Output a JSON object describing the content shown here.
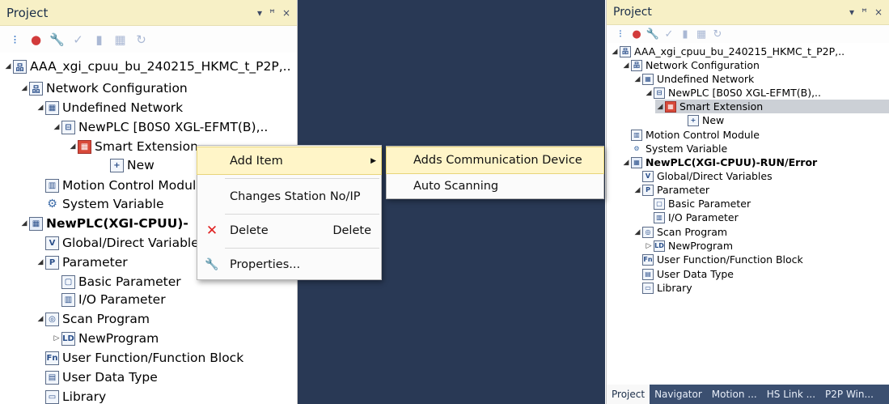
{
  "left": {
    "title": "Project",
    "title_controls": [
      "▾",
      "ꟸ",
      "×"
    ],
    "toolbar_icons": [
      "fault-list-icon",
      "error-icon",
      "wrench-icon",
      "check-icon",
      "lock-icon",
      "compare-icon",
      "refresh-icon"
    ],
    "tree": [
      {
        "id": "root",
        "toggle": "◢",
        "icon": "品",
        "label": "AAA_xgi_cpuu_bu_240215_HKMC_t_P2P,.."
      },
      {
        "id": "netcfg",
        "toggle": "◢",
        "icon": "品",
        "label": "Network Configuration"
      },
      {
        "id": "undef",
        "toggle": "◢",
        "icon": "▦",
        "label": "Undefined Network"
      },
      {
        "id": "newplc",
        "toggle": "◢",
        "icon": "⊟",
        "label": "NewPLC [B0S0 XGL-EFMT(B),.."
      },
      {
        "id": "smart",
        "toggle": "◢",
        "icon": "▦",
        "label": "Smart Extension"
      },
      {
        "id": "new",
        "toggle": "",
        "icon": "+",
        "label": "New"
      },
      {
        "id": "motion",
        "toggle": "",
        "icon": "▥",
        "label": "Motion Control Module"
      },
      {
        "id": "sysvar",
        "toggle": "",
        "icon": "⚙",
        "label": "System Variable"
      },
      {
        "id": "plc",
        "toggle": "◢",
        "icon": "▦",
        "label": "NewPLC(XGI-CPUU)-"
      },
      {
        "id": "global",
        "toggle": "",
        "icon": "V",
        "label": "Global/Direct Variables"
      },
      {
        "id": "param",
        "toggle": "◢",
        "icon": "P",
        "label": "Parameter"
      },
      {
        "id": "basic",
        "toggle": "",
        "icon": "▢",
        "label": "Basic Parameter"
      },
      {
        "id": "io",
        "toggle": "",
        "icon": "▥",
        "label": "I/O Parameter"
      },
      {
        "id": "scan",
        "toggle": "◢",
        "icon": "◎",
        "label": "Scan Program"
      },
      {
        "id": "newprog",
        "toggle": "▷",
        "icon": "LD",
        "label": "NewProgram"
      },
      {
        "id": "ufb",
        "toggle": "",
        "icon": "Fn",
        "label": "User Function/Function Block"
      },
      {
        "id": "udt",
        "toggle": "",
        "icon": "▤",
        "label": "User Data Type"
      },
      {
        "id": "lib",
        "toggle": "",
        "icon": "▭",
        "label": "Library"
      }
    ]
  },
  "context_menu": {
    "items": [
      {
        "label": "Add Item",
        "icon": "",
        "shortcut": "",
        "submenu": true
      },
      {
        "label": "Changes Station No/IP",
        "icon": "",
        "shortcut": "",
        "submenu": false
      },
      {
        "label": "Delete",
        "icon": "✕",
        "shortcut": "Delete",
        "submenu": false
      },
      {
        "label": "Properties...",
        "icon": "🔧",
        "shortcut": "",
        "submenu": false
      }
    ],
    "submenu": [
      "Adds Communication Device",
      "Auto Scanning"
    ]
  },
  "right": {
    "title": "Project",
    "title_controls": [
      "▾",
      "ꟸ",
      "×"
    ],
    "tree": [
      {
        "id": "root",
        "toggle": "◢",
        "icon": "品",
        "label": "AAA_xgi_cpuu_bu_240215_HKMC_t_P2P,.."
      },
      {
        "id": "netcfg",
        "toggle": "◢",
        "icon": "品",
        "label": "Network Configuration"
      },
      {
        "id": "undef",
        "toggle": "◢",
        "icon": "▦",
        "label": "Undefined Network"
      },
      {
        "id": "newplc",
        "toggle": "◢",
        "icon": "⊟",
        "label": "NewPLC [B0S0 XGL-EFMT(B),.."
      },
      {
        "id": "smart",
        "toggle": "◢",
        "icon": "▦",
        "label": "Smart Extension"
      },
      {
        "id": "new",
        "toggle": "",
        "icon": "+",
        "label": "New"
      },
      {
        "id": "motion",
        "toggle": "",
        "icon": "▥",
        "label": "Motion Control Module"
      },
      {
        "id": "sysvar",
        "toggle": "",
        "icon": "⚙",
        "label": "System Variable"
      },
      {
        "id": "plc",
        "toggle": "◢",
        "icon": "▦",
        "label": "NewPLC(XGI-CPUU)-RUN/Error"
      },
      {
        "id": "global",
        "toggle": "",
        "icon": "V",
        "label": "Global/Direct Variables"
      },
      {
        "id": "param",
        "toggle": "◢",
        "icon": "P",
        "label": "Parameter"
      },
      {
        "id": "basic",
        "toggle": "",
        "icon": "▢",
        "label": "Basic Parameter"
      },
      {
        "id": "io",
        "toggle": "",
        "icon": "▥",
        "label": "I/O Parameter"
      },
      {
        "id": "scan",
        "toggle": "◢",
        "icon": "◎",
        "label": "Scan Program"
      },
      {
        "id": "newprog",
        "toggle": "▷",
        "icon": "LD",
        "label": "NewProgram"
      },
      {
        "id": "ufb",
        "toggle": "",
        "icon": "Fn",
        "label": "User Function/Function Block"
      },
      {
        "id": "udt",
        "toggle": "",
        "icon": "▤",
        "label": "User Data Type"
      },
      {
        "id": "lib",
        "toggle": "",
        "icon": "▭",
        "label": "Library"
      }
    ],
    "tabs": [
      "Project",
      "Navigator",
      "Motion ...",
      "HS Link ...",
      "P2P Win..."
    ]
  },
  "colors": {
    "title_bg": "#f7f0c6",
    "middle_bg": "#293955",
    "selection": "#ccd0d6",
    "menu_highlight": "#fff5c8",
    "delete_icon": "#e02020"
  }
}
